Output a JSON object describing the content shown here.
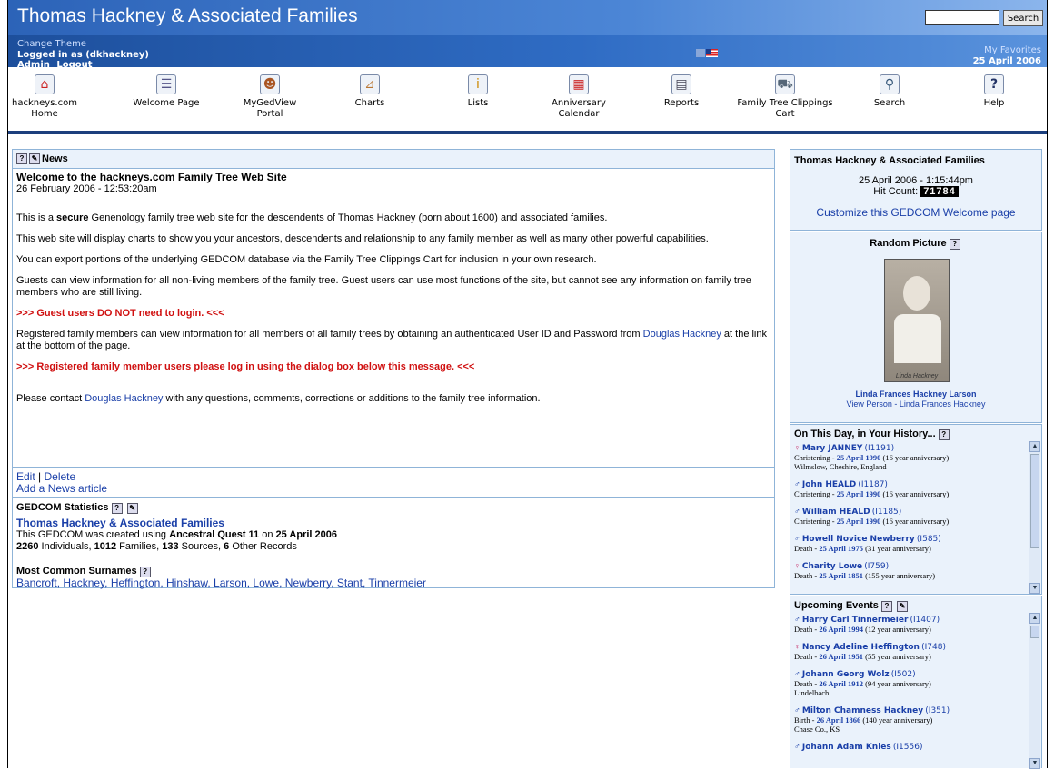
{
  "header": {
    "title": "Thomas Hackney & Associated Families",
    "search_button": "Search",
    "change_theme": "Change Theme",
    "logged_in": "Logged in as (dkhackney)",
    "admin": "Admin",
    "logout": "Logout",
    "favorites": "My Favorites",
    "date": "25 April 2006"
  },
  "nav": {
    "items": [
      {
        "label": "hackneys.com Home",
        "icon": "home-icon"
      },
      {
        "label": "Welcome Page",
        "icon": "welcome-icon"
      },
      {
        "label": "MyGedView Portal",
        "icon": "portal-icon"
      },
      {
        "label": "Charts",
        "icon": "charts-icon"
      },
      {
        "label": "Lists",
        "icon": "lists-icon"
      },
      {
        "label": "Anniversary Calendar",
        "icon": "calendar-icon"
      },
      {
        "label": "Reports",
        "icon": "reports-icon"
      },
      {
        "label": "Family Tree Clippings Cart",
        "icon": "cart-icon"
      },
      {
        "label": "Search",
        "icon": "search-icon"
      },
      {
        "label": "Help",
        "icon": "help-icon"
      }
    ]
  },
  "news": {
    "heading": "News",
    "title": "Welcome to the hackneys.com Family Tree Web Site",
    "date": "26 February 2006 - 12:53:20am",
    "p1_pre": "This is a ",
    "p1_bold": "secure",
    "p1_post": " Genenology family tree web site for the descendents of Thomas Hackney (born about 1600) and associated families.",
    "p2": "This web site will display charts to show you your ancestors, descendents and relationship to any family member as well as many other powerful capabilities.",
    "p3": "You can export portions of the underlying GEDCOM database via the Family Tree Clippings Cart for inclusion in your own research.",
    "p4": "Guests can view information for all non-living members of the family tree. Guest users can use most functions of the site, but cannot see any information on family tree members who are still living.",
    "p5": ">>> Guest users DO NOT need to login. <<<",
    "p6_pre": "Registered family members can view information for all members of all family trees by obtaining an authenticated User ID and Password from ",
    "p6_link": "Douglas Hackney",
    "p6_post": " at the link at the bottom of the page.",
    "p7": ">>> Registered family member users please log in using the dialog box below this message. <<<",
    "p8_pre": "Please contact ",
    "p8_link": "Douglas Hackney",
    "p8_post": " with any questions, comments, corrections or additions to the family tree information.",
    "edit": "Edit",
    "delete": "Delete",
    "add_article": "Add a News article"
  },
  "stats": {
    "heading": "GEDCOM Statistics",
    "title": "Thomas Hackney & Associated Families",
    "created_pre": "This GEDCOM was created using ",
    "software": "Ancestral Quest 11",
    "on": " on ",
    "created_date": "25 April 2006",
    "individuals": "2260",
    "individuals_label": " Individuals, ",
    "families": "1012",
    "families_label": " Families, ",
    "sources": "133",
    "sources_label": " Sources, ",
    "other": "6",
    "other_label": " Other Records",
    "surnames_heading": "Most Common Surnames",
    "surnames": [
      "Bancroft",
      "Hackney",
      "Heffington",
      "Hinshaw",
      "Larson",
      "Lowe",
      "Newberry",
      "Stant",
      "Tinnermeier"
    ]
  },
  "welcome_box": {
    "title": "Thomas Hackney & Associated Families",
    "datetime": "25 April 2006 - 1:15:44pm",
    "hit_label": "Hit Count: ",
    "hit_count": "71784",
    "customize": "Customize this GEDCOM Welcome page"
  },
  "random_picture": {
    "heading": "Random Picture",
    "signature": "Linda Hackney",
    "person": "Linda Frances Hackney Larson",
    "view": "View Person - Linda Frances Hackney"
  },
  "on_this_day": {
    "heading": "On This Day, in Your History...",
    "events": [
      {
        "sex": "F",
        "name": "Mary JANNEY",
        "id": "(I1191)",
        "event": "Christening - ",
        "date": "25 April 1990",
        "note": " (16 year anniversary)",
        "place": "Wilmslow, Cheshire, England"
      },
      {
        "sex": "M",
        "name": "John HEALD",
        "id": "(I1187)",
        "event": "Christening - ",
        "date": "25 April 1990",
        "note": " (16 year anniversary)",
        "place": ""
      },
      {
        "sex": "M",
        "name": "William HEALD",
        "id": "(I1185)",
        "event": "Christening - ",
        "date": "25 April 1990",
        "note": " (16 year anniversary)",
        "place": ""
      },
      {
        "sex": "M",
        "name": "Howell Novice Newberry",
        "id": "(I585)",
        "event": "Death - ",
        "date": "25 April 1975",
        "note": " (31 year anniversary)",
        "place": ""
      },
      {
        "sex": "F",
        "name": "Charity Lowe",
        "id": "(I759)",
        "event": "Death - ",
        "date": "25 April 1851",
        "note": " (155 year anniversary)",
        "place": ""
      }
    ]
  },
  "upcoming": {
    "heading": "Upcoming Events",
    "events": [
      {
        "sex": "M",
        "name": "Harry Carl Tinnermeier",
        "id": "(I1407)",
        "event": "Death - ",
        "date": "26 April 1994",
        "note": " (12 year anniversary)",
        "place": ""
      },
      {
        "sex": "F",
        "name": "Nancy Adeline Heffington",
        "id": "(I748)",
        "event": "Death - ",
        "date": "26 April 1951",
        "note": " (55 year anniversary)",
        "place": ""
      },
      {
        "sex": "M",
        "name": "Johann Georg Wolz",
        "id": "(I502)",
        "event": "Death - ",
        "date": "26 April 1912",
        "note": " (94 year anniversary)",
        "place": "Lindelbach"
      },
      {
        "sex": "M",
        "name": "Milton Chamness Hackney",
        "id": "(I351)",
        "event": "Birth - ",
        "date": "26 April 1866",
        "note": " (140 year anniversary)",
        "place": "Chase Co., KS"
      },
      {
        "sex": "M",
        "name": "Johann Adam Knies",
        "id": "(I1556)",
        "event": "",
        "date": "",
        "note": "",
        "place": ""
      }
    ]
  }
}
